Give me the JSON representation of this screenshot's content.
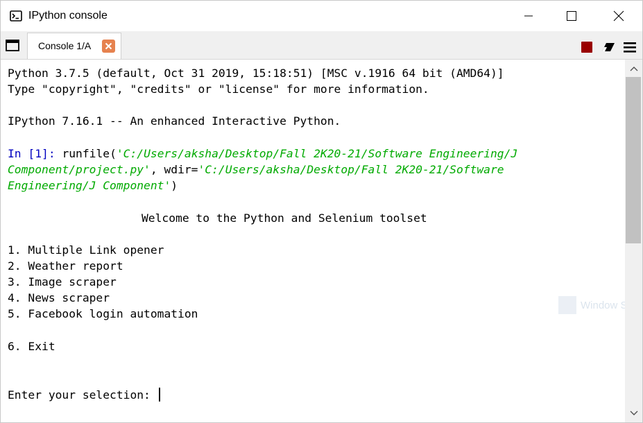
{
  "window": {
    "title": "IPython console"
  },
  "tab": {
    "label": "Console 1/A"
  },
  "console": {
    "lines": [
      "Python 3.7.5 (default, Oct 31 2019, 15:18:51) [MSC v.1916 64 bit (AMD64)]",
      "Type \"copyright\", \"credits\" or \"license\" for more information.",
      "IPython 7.16.1 -- An enhanced Interactive Python."
    ],
    "input": {
      "prompt": "In [",
      "number": "1",
      "prompt_end": "]: ",
      "func": "runfile(",
      "path1": "'C:/Users/aksha/Desktop/Fall 2K20-21/Software Engineering/J",
      "path2": "Component/project.py'",
      "mid": ", wdir=",
      "path3": "'C:/Users/aksha/Desktop/Fall 2K20-21/Software",
      "path4": "Engineering/J Component'",
      "close": ")"
    },
    "welcome": "Welcome to the Python and Selenium toolset",
    "menu": [
      "1. Multiple Link opener",
      "2. Weather report",
      "3. Image scraper",
      "4. News scraper",
      "5. Facebook login automation"
    ],
    "exit": "6. Exit",
    "selection_prompt": "Enter your selection: "
  },
  "watermark": {
    "text": "Window S"
  },
  "colors": {
    "prompt": "#0000c0",
    "string": "#00aa00",
    "stop_button": "#990000",
    "tab_close": "#e6824f"
  }
}
